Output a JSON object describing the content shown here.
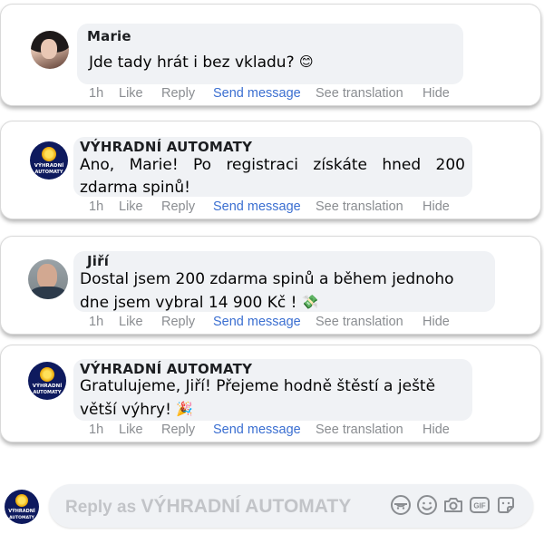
{
  "comments": [
    {
      "author": "Marie",
      "text": "Jde tady hrát i bez vkladu?",
      "emoji": "😊",
      "actions": {
        "time": "1h",
        "like": "Like",
        "reply": "Reply",
        "send": "Send message",
        "translate": "See translation",
        "hide": "Hide"
      }
    },
    {
      "author": "VÝHRADNÍ AUTOMATY",
      "text": "Ano, Marie! Po registraci získáte hned 200 zdarma spinů!",
      "emoji": "",
      "actions": {
        "time": "1h",
        "like": "Like",
        "reply": "Reply",
        "send": "Send message",
        "translate": "See translation",
        "hide": "Hide"
      }
    },
    {
      "author": "Jiří",
      "text": "Dostal jsem 200 zdarma spinů a během jednoho dne jsem vybral 14 900 Kč !",
      "emoji": "💸",
      "actions": {
        "time": "1h",
        "like": "Like",
        "reply": "Reply",
        "send": "Send message",
        "translate": "See translation",
        "hide": "Hide"
      }
    },
    {
      "author": "VÝHRADNÍ AUTOMATY",
      "text": "Gratulujeme, Jiří! Přejeme hodně štěstí a ještě větší výhry!",
      "emoji": "🎉",
      "actions": {
        "time": "1h",
        "like": "Like",
        "reply": "Reply",
        "send": "Send message",
        "translate": "See translation",
        "hide": "Hide"
      }
    }
  ],
  "logo": {
    "line1": "VÝHRADNÍ",
    "line2": "AUTOMATY"
  },
  "reply_bar": {
    "prefix": "Reply as",
    "brand": "VÝHRADNÍ AUTOMATY"
  },
  "reply_icons": [
    "avatar-sticker-icon",
    "emoji-icon",
    "camera-icon",
    "gif-icon",
    "sticker-icon"
  ],
  "reply_gif_label": "GIF",
  "colors": {
    "send_message": "#3b6fd1",
    "action_text": "#8a8d91",
    "bubble": "#f0f2f5",
    "logo_bg": "#0e1a5e"
  }
}
